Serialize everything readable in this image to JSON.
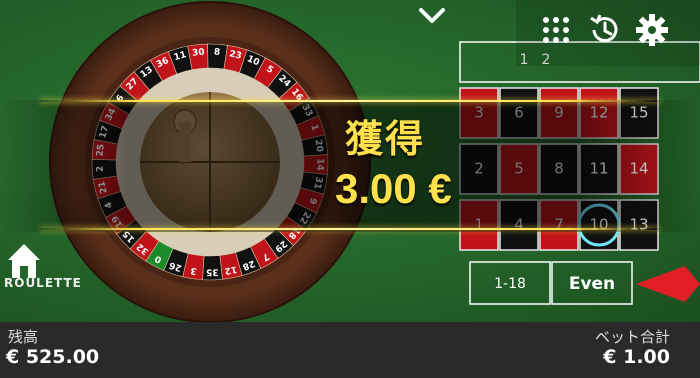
{
  "window": {
    "nav": "ROULETTE"
  },
  "balance": {
    "label": "残高",
    "value": "€ 525.00"
  },
  "total_bet": {
    "label": "ベット合計",
    "value": "€ 1.00"
  },
  "win": {
    "label": "獲得",
    "amount": "3.00 €"
  },
  "wheel": {
    "numbers": [
      "13",
      "36",
      "11",
      "30",
      "8",
      "23",
      "10",
      "5",
      "24",
      "16",
      "33",
      "1",
      "20",
      "14",
      "31",
      "9",
      "22",
      "18",
      "29",
      "7",
      "28",
      "12",
      "35",
      "3",
      "26",
      "0",
      "32",
      "15",
      "19",
      "4",
      "21",
      "2",
      "25",
      "17",
      "34",
      "6",
      "27"
    ],
    "colors": {
      "red": "#c0141a",
      "black": "#111111",
      "green": "#1a8a2a"
    }
  },
  "table": {
    "top_row": [
      "1",
      "2"
    ],
    "rows": [
      [
        "3",
        "6",
        "9",
        "12",
        "15"
      ],
      [
        "2",
        "5",
        "8",
        "11",
        "14"
      ],
      [
        "1",
        "4",
        "7",
        "10",
        "13"
      ]
    ],
    "outside_bets": [
      "1-18",
      "Even"
    ],
    "highlighted": "10"
  },
  "icons": {
    "chevron": "chevron-down-icon",
    "chips": "chip-grid-icon",
    "history": "history-icon",
    "settings": "gear-icon",
    "home": "home-icon"
  }
}
